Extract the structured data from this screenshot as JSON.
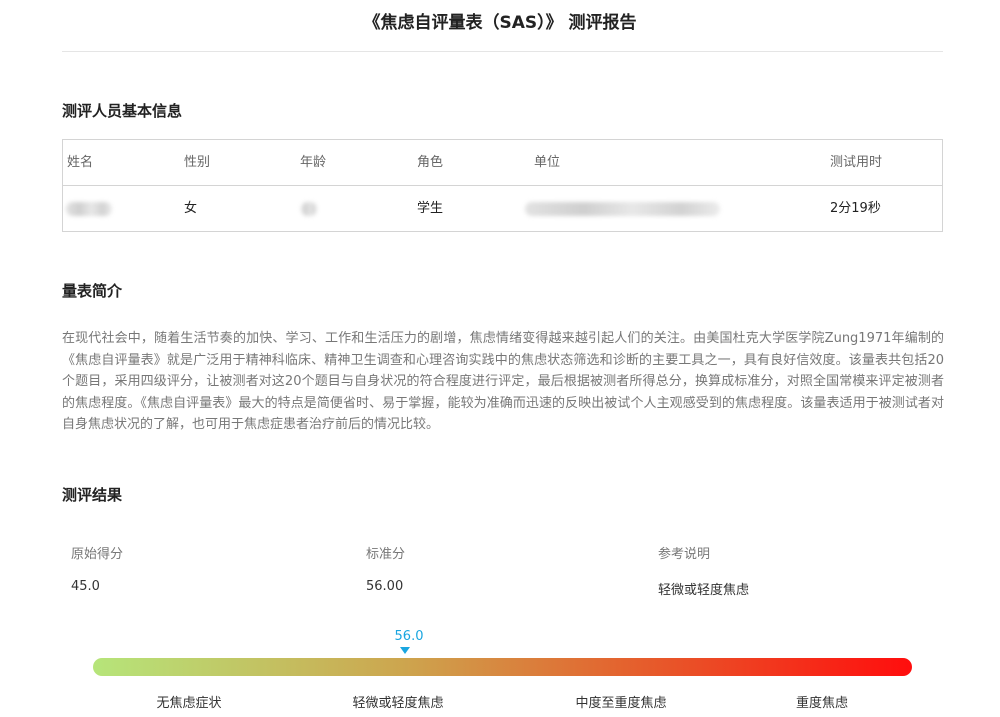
{
  "report": {
    "title": "《焦虑自评量表（SAS）》 测评报告"
  },
  "sections": {
    "basic_info": "测评人员基本信息",
    "intro": "量表简介",
    "results": "测评结果"
  },
  "info_table": {
    "headers": [
      "姓名",
      "性别",
      "年龄",
      "角色",
      "单位",
      "测试用时"
    ],
    "row": {
      "gender": "女",
      "role": "学生",
      "duration": "2分19秒"
    }
  },
  "intro_text": "在现代社会中，随着生活节奏的加快、学习、工作和生活压力的剧增，焦虑情绪变得越来越引起人们的关注。由美国杜克大学医学院Zung1971年编制的《焦虑自评量表》就是广泛用于精神科临床、精神卫生调查和心理咨询实践中的焦虑状态筛选和诊断的主要工具之一，具有良好信效度。该量表共包括20个题目，采用四级评分，让被测者对这20个题目与自身状况的符合程度进行评定，最后根据被测者所得总分，换算成标准分，对照全国常模来评定被测者的焦虑程度。《焦虑自评量表》最大的特点是简便省时、易于掌握，能较为准确而迅速的反映出被试个人主观感受到的焦虑程度。该量表适用于被测试者对自身焦虑状况的了解，也可用于焦虑症患者治疗前后的情况比较。",
  "results": {
    "raw_label": "原始得分",
    "raw_value": "45.0",
    "std_label": "标准分",
    "std_value": "56.00",
    "ref_label": "参考说明",
    "ref_value": "轻微或轻度焦虑"
  },
  "scale": {
    "marker_label": "56.0",
    "marker_fraction": 0.381,
    "levels": [
      "无焦虑症状",
      "轻微或轻度焦虑",
      "中度至重度焦虑",
      "重度焦虑"
    ],
    "colors": {
      "start": "#b6e57a",
      "end": "#ff0d0d",
      "marker": "#1aa6e0"
    }
  }
}
